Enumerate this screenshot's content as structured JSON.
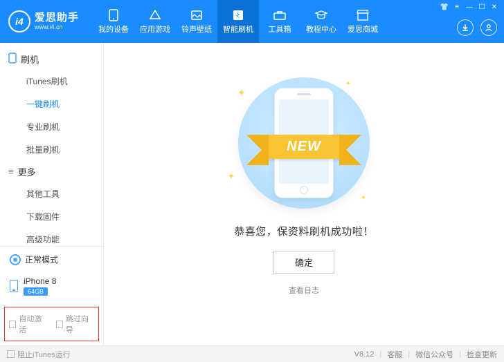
{
  "brand": {
    "short": "i4",
    "name": "爱思助手",
    "url": "www.i4.cn"
  },
  "nav": {
    "items": [
      {
        "label": "我的设备"
      },
      {
        "label": "应用游戏"
      },
      {
        "label": "铃声壁纸"
      },
      {
        "label": "智能刷机"
      },
      {
        "label": "工具箱"
      },
      {
        "label": "教程中心"
      },
      {
        "label": "爱思商城"
      }
    ]
  },
  "sidebar": {
    "groups": [
      {
        "title": "刷机",
        "items": [
          "iTunes刷机",
          "一键刷机",
          "专业刷机",
          "批量刷机"
        ]
      },
      {
        "title": "更多",
        "items": [
          "其他工具",
          "下载固件",
          "高级功能"
        ]
      }
    ],
    "mode_label": "正常模式",
    "device": {
      "name": "iPhone 8",
      "capacity": "64GB"
    },
    "options": {
      "auto_activate": "自动激活",
      "skip_guide": "跳过向导"
    }
  },
  "main": {
    "ribbon_text": "NEW",
    "success_msg": "恭喜您，保资料刷机成功啦！",
    "ok_label": "确定",
    "view_log": "查看日志"
  },
  "status": {
    "block_itunes": "阻止iTunes运行",
    "version": "V8.12",
    "support": "客服",
    "wechat": "微信公众号",
    "update": "检查更新"
  }
}
